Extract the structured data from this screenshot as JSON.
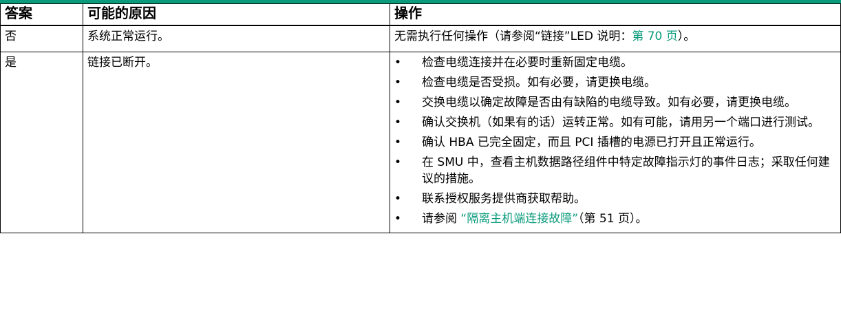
{
  "table": {
    "headers": [
      "答案",
      "可能的原因",
      "操作"
    ],
    "rows": [
      {
        "answer": "否",
        "cause": "系统正常运行。",
        "action_text": "无需执行任何操作（请参阅“链接”LED 说明：",
        "action_link": "第 70 页",
        "action_tail": "）。"
      },
      {
        "answer": "是",
        "cause": "链接已断开。",
        "actions": [
          {
            "text": "检查电缆连接并在必要时重新固定电缆。"
          },
          {
            "text": "检查电缆是否受损。如有必要，请更换电缆。"
          },
          {
            "text": "交换电缆以确定故障是否由有缺陷的电缆导致。如有必要，请更换电缆。"
          },
          {
            "text": "确认交换机（如果有的话）运转正常。如有可能，请用另一个端口进行测试。"
          },
          {
            "text": "确认 HBA 已完全固定，而且 PCI 插槽的电源已打开且正常运行。"
          },
          {
            "text": "在 SMU 中，查看主机数据路径组件中特定故障指示灯的事件日志；采取任何建议的措施。"
          },
          {
            "text": "联系授权服务提供商获取帮助。"
          },
          {
            "prefix": "请参阅 ",
            "link": "“隔离主机端连接故障”",
            "suffix": "（第 51 页）。"
          }
        ]
      }
    ]
  }
}
